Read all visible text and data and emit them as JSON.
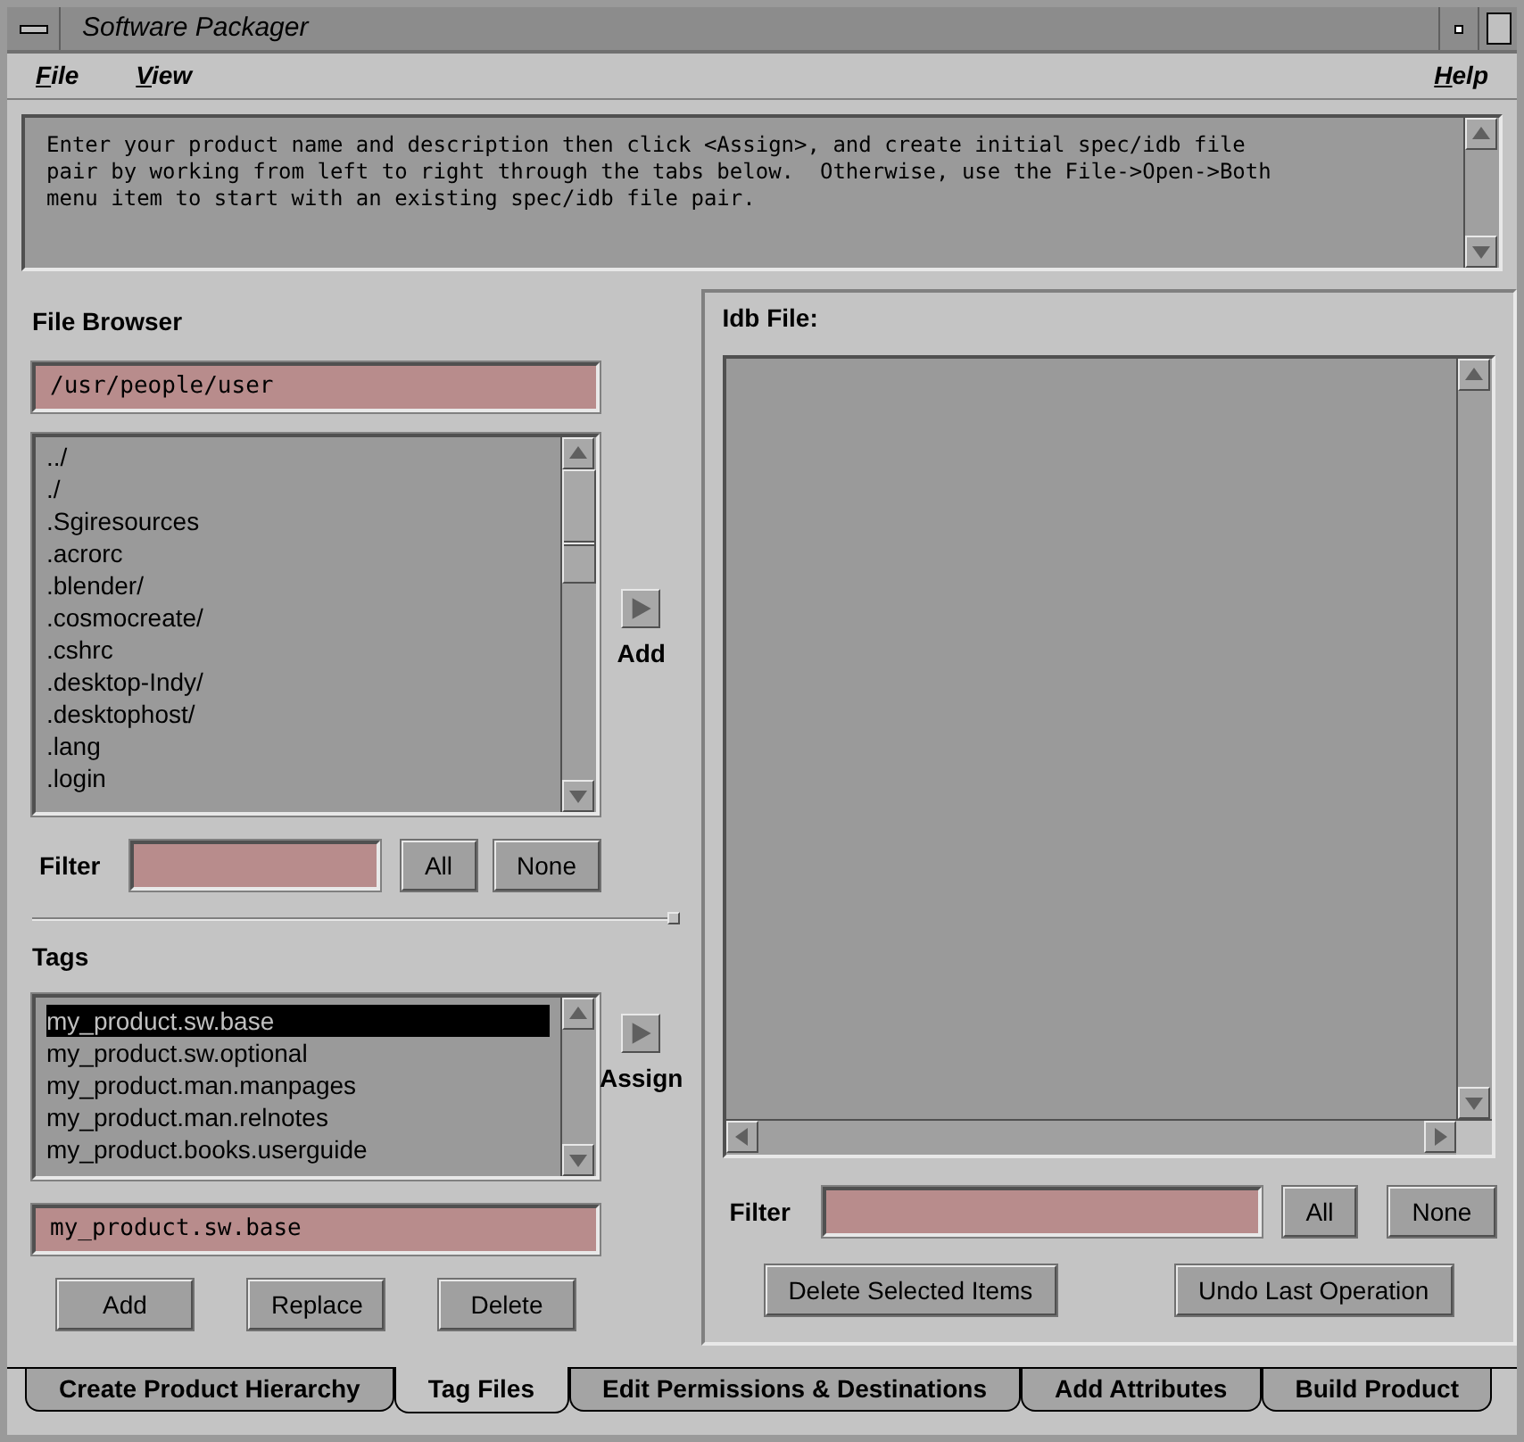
{
  "window": {
    "title": "Software Packager"
  },
  "menu": {
    "items": [
      "File",
      "View"
    ],
    "help": "Help"
  },
  "message": {
    "lines": [
      "Enter your product name and description then click <Assign>, and create initial spec/idb file",
      "pair by working from left to right through the tabs below.  Otherwise, use the File->Open->Both",
      "menu item to start with an existing spec/idb file pair."
    ]
  },
  "file_browser": {
    "title": "File Browser",
    "path": "/usr/people/user",
    "items": [
      "../",
      "./",
      ".Sgiresources",
      ".acrorc",
      ".blender/",
      ".cosmocreate/",
      ".cshrc",
      ".desktop-Indy/",
      ".desktophost/",
      ".lang",
      ".login"
    ],
    "filter_label": "Filter",
    "buttons": [
      "All",
      "None"
    ],
    "add": "Add"
  },
  "tags": {
    "title": "Tags",
    "items": [
      {
        "label": "my_product.sw.base",
        "selected": true
      },
      {
        "label": "my_product.sw.optional",
        "selected": false
      },
      {
        "label": "my_product.man.manpages",
        "selected": false
      },
      {
        "label": "my_product.man.relnotes",
        "selected": false
      },
      {
        "label": "my_product.books.userguide",
        "selected": false
      }
    ],
    "value": "my_product.sw.base",
    "buttons": [
      "Add",
      "Replace",
      "Delete"
    ],
    "assign": "Assign"
  },
  "idb_file": {
    "title": "Idb File:",
    "filter_label": "Filter",
    "filter_buttons": [
      "All",
      "None"
    ],
    "buttons": [
      "Delete Selected Items",
      "Undo Last Operation"
    ]
  },
  "tabs": [
    {
      "label": "Create Product Hierarchy",
      "selected": false
    },
    {
      "label": "Tag Files",
      "selected": true
    },
    {
      "label": "Edit Permissions & Destinations",
      "selected": false
    },
    {
      "label": "Add Attributes",
      "selected": false
    },
    {
      "label": "Build Product",
      "selected": false
    }
  ]
}
